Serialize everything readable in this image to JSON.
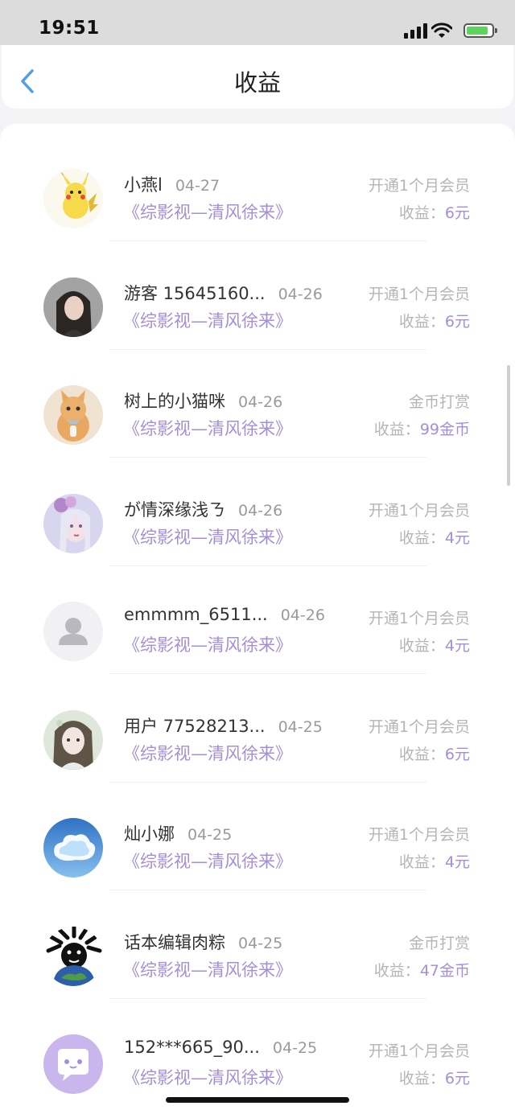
{
  "status_bar": {
    "time": "19:51"
  },
  "header": {
    "title": "收益"
  },
  "earn_prefix": "收益：",
  "colors": {
    "accent": "#a48ed6",
    "back": "#4ea0e6"
  },
  "items": [
    {
      "name": "小燕l",
      "date": "04-27",
      "book": "《综影视—清风徐来》",
      "type": "开通1个月会员",
      "amount": "6元",
      "avatar": "pikachu-avatar"
    },
    {
      "name": "游客 15645160...",
      "date": "04-26",
      "book": "《综影视—清风徐来》",
      "type": "开通1个月会员",
      "amount": "6元",
      "avatar": "girl-photo-avatar"
    },
    {
      "name": "树上的小猫咪",
      "date": "04-26",
      "book": "《综影视—清风徐来》",
      "type": "金币打赏",
      "amount": "99金币",
      "avatar": "cat-avatar"
    },
    {
      "name": "が情深缘浅ㄋ",
      "date": "04-26",
      "book": "《综影视—清风徐来》",
      "type": "开通1个月会员",
      "amount": "4元",
      "avatar": "flower-girl-avatar"
    },
    {
      "name": "emmmm_6511...",
      "date": "04-26",
      "book": "《综影视—清风徐来》",
      "type": "开通1个月会员",
      "amount": "4元",
      "avatar": "default-user-avatar"
    },
    {
      "name": "用户 77528213...",
      "date": "04-25",
      "book": "《综影视—清风徐来》",
      "type": "开通1个月会员",
      "amount": "6元",
      "avatar": "anime-girl-avatar"
    },
    {
      "name": "灿小娜",
      "date": "04-25",
      "book": "《综影视—清风徐来》",
      "type": "开通1个月会员",
      "amount": "4元",
      "avatar": "cloud-avatar"
    },
    {
      "name": "话本编辑肉粽",
      "date": "04-25",
      "book": "《综影视—清风徐来》",
      "type": "金币打赏",
      "amount": "47金币",
      "avatar": "earth-avatar"
    },
    {
      "name": "152***665_90...",
      "date": "04-25",
      "book": "《综影视—清风徐来》",
      "type": "开通1个月会员",
      "amount": "6元",
      "avatar": "chat-bubble-avatar"
    }
  ]
}
